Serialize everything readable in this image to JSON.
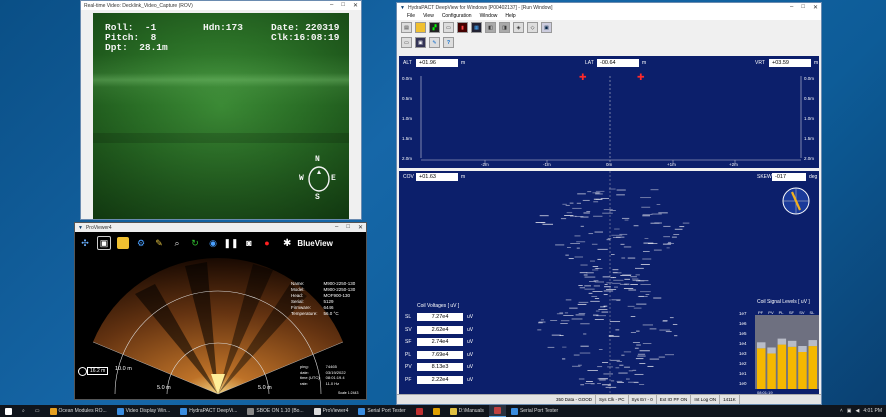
{
  "video_window": {
    "title": "Real-time Video: Decklink_Video_Capture (ROV)",
    "osd": {
      "roll": "Roll:  -1",
      "hdn": "Hdn:173",
      "date": "Date: 220319",
      "pitch": "Pitch:  8",
      "clk": "Clk:16:08:19",
      "dpt": "Dpt:  28.1m"
    },
    "compass": {
      "n": "N",
      "e": "E",
      "s": "S",
      "w": "W"
    }
  },
  "sonar_window": {
    "title": "ProViewer4",
    "brand": "BlueView",
    "info_labels": [
      "Name:",
      "Model:",
      "Head:",
      "Serial:",
      "Firmware:",
      "Temperature:"
    ],
    "info_values": [
      "M900-2250-130",
      "M900-2250-130",
      "MOF900-130",
      "5129",
      "6446",
      "56.0 °C"
    ],
    "range_labels": [
      "10.0 m",
      "5.0 m",
      "5.0 m"
    ],
    "range_box": "16.2 m",
    "ping": {
      "labels": [
        "ping:",
        "date:",
        "time (UTC):",
        "rate:"
      ],
      "values": [
        "74465",
        "03/19/2022",
        "08:01:19.4",
        "11.0 Hz"
      ]
    },
    "scale_hint": "Scale 1:2443"
  },
  "hydra_window": {
    "title": "HydraPACT DeepView for Windows [P00402137] - [Run Window]",
    "menu": [
      "File",
      "View",
      "Configuration",
      "Window",
      "Help"
    ],
    "top": {
      "alt_label": "ALT",
      "alt_value": "+01.96",
      "alt_unit": "m",
      "lat_label": "LAT",
      "lat_value": "-00.64",
      "lat_unit": "m",
      "vrt_label": "VRT",
      "vrt_value": "+03.59",
      "vrt_unit": "m",
      "depth_ticks": [
        "0.0m",
        "0.5m",
        "1.0m",
        "1.5m",
        "2.0m"
      ],
      "x_ticks": [
        "-2m",
        "-1m",
        "0m",
        "+1m",
        "+2m"
      ]
    },
    "bottom": {
      "cov_label": "COV",
      "cov_value": "+01.63",
      "cov_unit": "m",
      "skew_label": "SKEW",
      "skew_value": "-017",
      "skew_unit": "deg"
    },
    "coil_voltages": {
      "title": "Coil Voltages [ uV ]",
      "rows": [
        {
          "label": "SL",
          "value": "7.27e4",
          "unit": "uV"
        },
        {
          "label": "SV",
          "value": "2.62e4",
          "unit": "uV"
        },
        {
          "label": "SF",
          "value": "2.74e4",
          "unit": "uV"
        },
        {
          "label": "PL",
          "value": "7.69e4",
          "unit": "uV"
        },
        {
          "label": "PV",
          "value": "8.13e3",
          "unit": "uV"
        },
        {
          "label": "PF",
          "value": "2.22e4",
          "unit": "uV"
        }
      ]
    },
    "coil_signal": {
      "title": "Coil Signal Levels [ uV ]",
      "cols": [
        "PF",
        "PV",
        "PL",
        "SF",
        "SV",
        "SL"
      ],
      "levels": [
        0.55,
        0.48,
        0.6,
        0.57,
        0.5,
        0.58
      ],
      "y_ticks": [
        "1e7",
        "1e6",
        "1e5",
        "1e4",
        "1e3",
        "1e2",
        "1e1",
        "1e0"
      ],
      "time": "08:01:19"
    },
    "status": [
      "350 Data - GOOD",
      "Sys Clk - PC",
      "Sys Err - 0",
      "Ext IO PF ON",
      "Int Log ON",
      "1411K"
    ]
  },
  "taskbar": {
    "items": [
      "Ocean Modules RO...",
      "Video Display Win...",
      "HydraPACT DeepVi...",
      "SBOE ON 1.10 (Bo...",
      "ProViewer4",
      "Serial Port Tester",
      "",
      "",
      "D:\\Manuals",
      "",
      "Serial Port Tester"
    ],
    "clock": "4:01 PM"
  }
}
